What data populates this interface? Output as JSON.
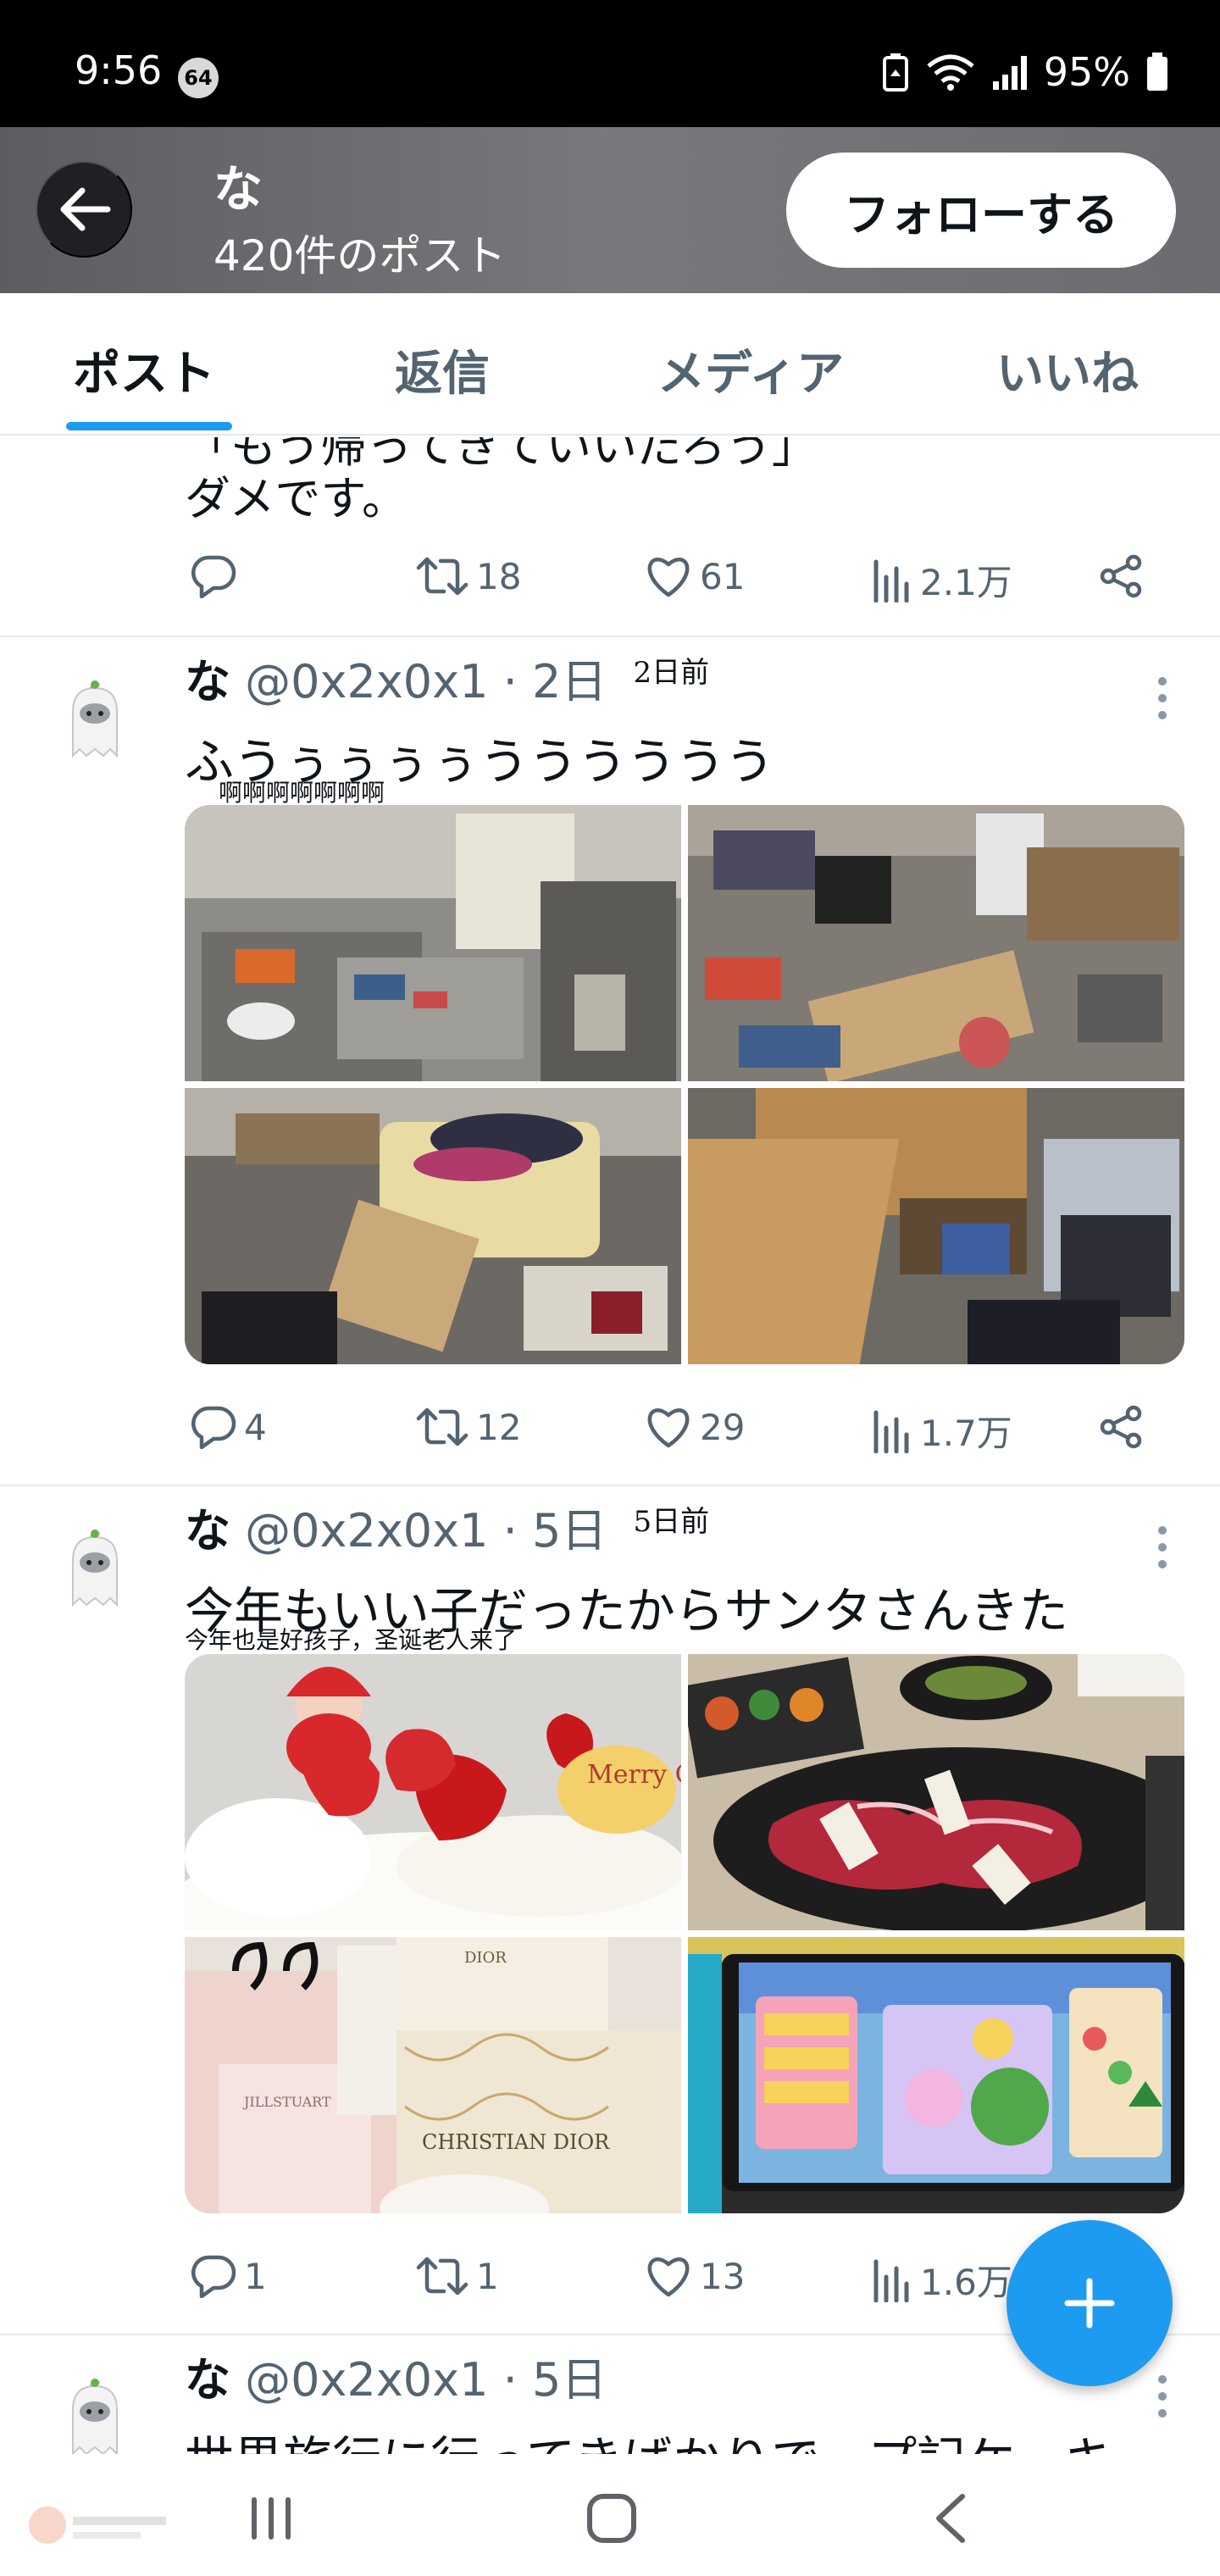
{
  "status_bar": {
    "time": "9:56",
    "notification_count": "64",
    "battery": "95%"
  },
  "header": {
    "name": "な",
    "post_count": "420件のポスト",
    "follow_label": "フォローする"
  },
  "tabs": [
    {
      "label": "ポスト",
      "active": true
    },
    {
      "label": "返信",
      "active": false
    },
    {
      "label": "メディア",
      "active": false
    },
    {
      "label": "いいね",
      "active": false
    }
  ],
  "partial_post": {
    "cut_text": "「もう帰ってきていいだろう」",
    "text": "ダメです。",
    "stats": {
      "replies": "",
      "reposts": "18",
      "likes": "61",
      "views": "2.1万"
    }
  },
  "posts": [
    {
      "name": "な",
      "handle": "@0x2x0x1",
      "date": "2日",
      "translated_date": "2日前",
      "text": "ふうぅぅぅぅうううううう",
      "translation": "啊啊啊啊啊啊啊",
      "media": [
        "messy-kitchen",
        "messy-room",
        "messy-bedroom",
        "fallen-furniture"
      ],
      "stats": {
        "replies": "4",
        "reposts": "12",
        "likes": "29",
        "views": "1.7万"
      }
    },
    {
      "name": "な",
      "handle": "@0x2x0x1",
      "date": "5日",
      "translated_date": "5日前",
      "text": "今年もいい子だったからサンタさんきた",
      "translation": "今年也是好孩子，圣诞老人来了",
      "cake_text": "Merry Christmas",
      "box_text": "CHRISTIAN DIOR",
      "box_text2": "DIOR",
      "bag_text": "JILLSTUART",
      "media": [
        "christmas-cake",
        "yakiniku",
        "gift-bags",
        "game-screen"
      ],
      "stats": {
        "replies": "1",
        "reposts": "1",
        "likes": "13",
        "views": "1.6万"
      }
    },
    {
      "name": "な",
      "handle": "@0x2x0x1",
      "date": "5日",
      "text": "世界旅行に行ってきばかりで、プ記ケーキ"
    }
  ],
  "colors": {
    "accent": "#1d9bf0",
    "text_primary": "#0f1419",
    "text_secondary": "#536471"
  }
}
